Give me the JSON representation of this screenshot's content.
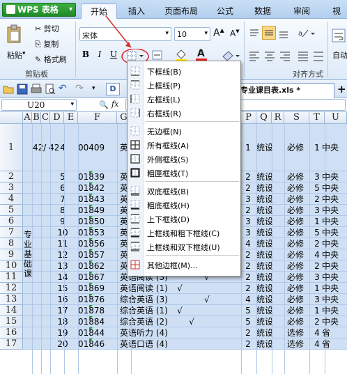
{
  "app": {
    "logo": "WPS 表格"
  },
  "tabs": [
    "开始",
    "插入",
    "页面布局",
    "公式",
    "数据",
    "审阅",
    "视"
  ],
  "ribbon": {
    "paste": "粘贴",
    "cut": "剪切",
    "copy": "复制",
    "format_painter": "格式刷",
    "clipboard": "剪贴板",
    "font_name": "宋体",
    "font_size": "10",
    "bold": "B",
    "italic": "I",
    "underline": "U",
    "grow": "A",
    "shrink": "A",
    "align_group": "对齐方式",
    "auto": "自动"
  },
  "doc": {
    "sheet_tab": "D",
    "filename": "专业课目表.xls *"
  },
  "formula": {
    "cell_ref": "U20",
    "fx": "fx"
  },
  "columns": [
    "A",
    "B",
    "C",
    "D",
    "E",
    "F",
    "G",
    "",
    "",
    "",
    "",
    "",
    "P",
    "Q",
    "R",
    "S",
    "T",
    "U"
  ],
  "rows": [
    {
      "n": "1",
      "c": "42/ 42",
      "d": "4",
      "e": "00409",
      "f": "英",
      "p": "1",
      "q": "统设",
      "s": "必修",
      "t": "1",
      "u": "中央"
    },
    {
      "n": "2",
      "d": "5",
      "e": "01839",
      "f": "英",
      "p": "2",
      "q": "统设",
      "s": "必修",
      "t": "3",
      "u": "中央"
    },
    {
      "n": "3",
      "d": "6",
      "e": "01842",
      "f": "英",
      "p": "2",
      "q": "统设",
      "s": "必修",
      "t": "5",
      "u": "中央"
    },
    {
      "n": "4",
      "d": "7",
      "e": "01843",
      "f": "英",
      "p": "3",
      "q": "统设",
      "s": "必修",
      "t": "2",
      "u": "中央"
    },
    {
      "n": "5",
      "d": "8",
      "e": "01849",
      "f": "英",
      "p": "2",
      "q": "统设",
      "s": "必修",
      "t": "3",
      "u": "中央"
    },
    {
      "n": "6",
      "d": "9",
      "e": "01850",
      "f": "英",
      "p": "3",
      "q": "统设",
      "s": "必修",
      "t": "1",
      "u": "中央"
    },
    {
      "n": "7",
      "d": "10",
      "e": "01853",
      "f": "英",
      "p": "3",
      "q": "统设",
      "s": "必修",
      "t": "5",
      "u": "中央"
    },
    {
      "n": "8",
      "d": "11",
      "e": "01856",
      "f": "英",
      "p": "4",
      "q": "统设",
      "s": "必修",
      "t": "2",
      "u": "中央"
    },
    {
      "n": "9",
      "d": "12",
      "e": "01857",
      "f": "英",
      "p": "2",
      "q": "统设",
      "s": "必修",
      "t": "4",
      "u": "中央"
    },
    {
      "n": "10",
      "d": "13",
      "e": "01862",
      "f": "英语阅读 (2)",
      "g": "",
      "h": "√",
      "p": "2",
      "q": "统设",
      "s": "必修",
      "t": "2",
      "u": "中央"
    },
    {
      "n": "11",
      "d": "14",
      "e": "01867",
      "f": "英语阅读 (3)",
      "g": "",
      "h": "",
      "i": "√",
      "p": "2",
      "q": "统设",
      "s": "必修",
      "t": "3",
      "u": "中央"
    },
    {
      "n": "12",
      "d": "15",
      "e": "01869",
      "f": "英语阅读 (1)",
      "g": "√",
      "p": "2",
      "q": "统设",
      "s": "必修",
      "t": "1",
      "u": "中央"
    },
    {
      "n": "13",
      "d": "16",
      "e": "01876",
      "f": "综合英语 (3)",
      "g": "",
      "h": "",
      "i": "√",
      "p": "4",
      "q": "统设",
      "s": "必修",
      "t": "3",
      "u": "中央"
    },
    {
      "n": "14",
      "d": "17",
      "e": "01878",
      "f": "综合英语 (1)",
      "g": "√",
      "p": "5",
      "q": "统设",
      "s": "必修",
      "t": "1",
      "u": "中央"
    },
    {
      "n": "15",
      "d": "18",
      "e": "01884",
      "f": "综合英语 (2)",
      "g": "",
      "h": "√",
      "p": "5",
      "q": "统设",
      "s": "必修",
      "t": "2",
      "u": "中央"
    },
    {
      "n": "16",
      "d": "19",
      "e": "01844",
      "f": "英语听力 (4)",
      "p": "2",
      "q": "统设",
      "s": "选修",
      "t": "4",
      "u": "省"
    },
    {
      "n": "17",
      "d": "20",
      "e": "01846",
      "f": "英语口语 (4)",
      "p": "2",
      "q": "统设",
      "s": "选修",
      "t": "4",
      "u": "省"
    }
  ],
  "merged_label": "专业基础课",
  "menu": {
    "items": [
      "下框线(B)",
      "上框线(P)",
      "左框线(L)",
      "右框线(R)",
      "无边框(N)",
      "所有框线(A)",
      "外侧框线(S)",
      "粗匣框线(T)",
      "双底框线(B)",
      "粗底框线(H)",
      "上下框线(D)",
      "上框线和粗下框线(C)",
      "上框线和双下框线(U)",
      "其他边框(M)..."
    ]
  }
}
